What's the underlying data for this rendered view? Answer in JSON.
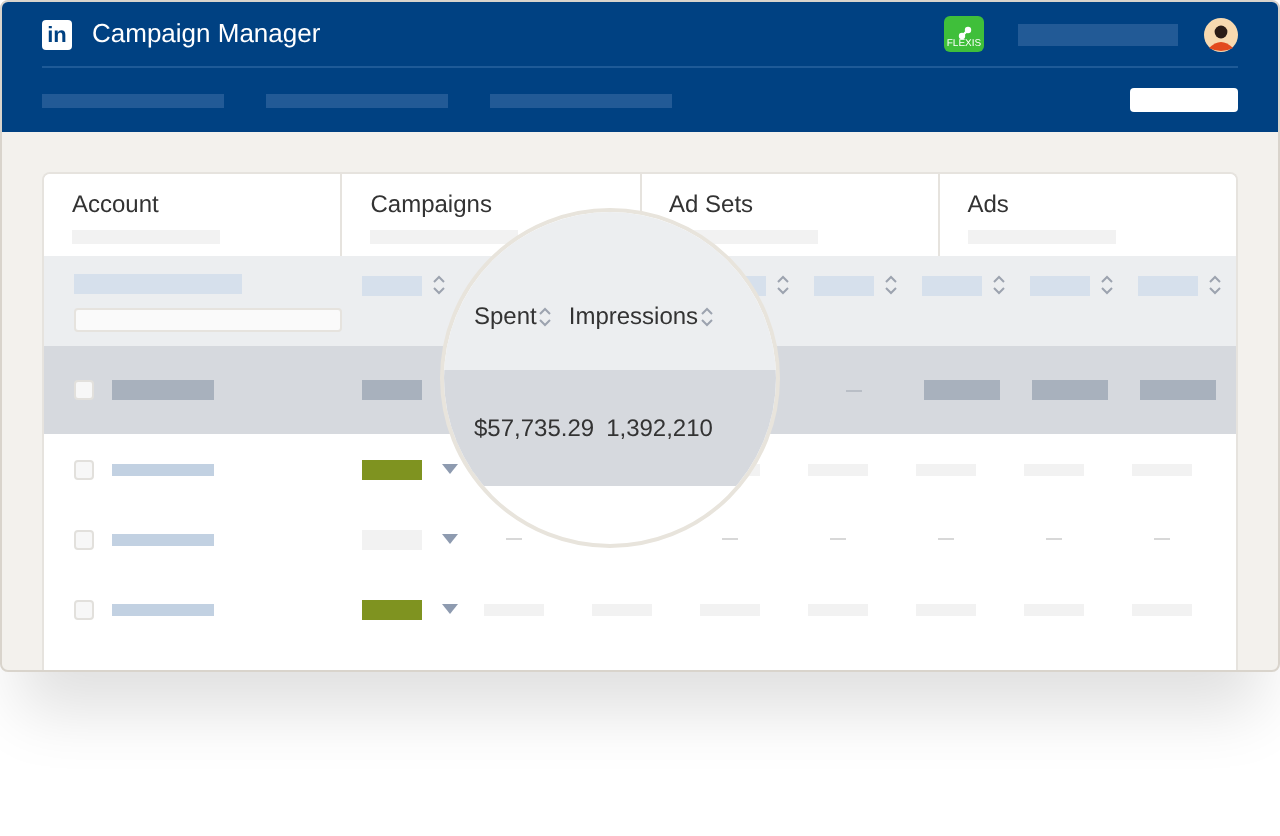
{
  "header": {
    "logo": "in",
    "title": "Campaign Manager",
    "app_icon_label": "FLEXIS"
  },
  "tabs": [
    {
      "label": "Account",
      "selected": false
    },
    {
      "label": "Campaigns",
      "selected": false
    },
    {
      "label": "Ad Sets",
      "selected": false
    },
    {
      "label": "Ads",
      "selected": false
    }
  ],
  "summary_row": {
    "checked": false
  },
  "rows": [
    {
      "checked": false,
      "active": true,
      "kind": "values"
    },
    {
      "checked": false,
      "active": false,
      "kind": "empty"
    },
    {
      "checked": false,
      "active": true,
      "kind": "values"
    }
  ],
  "magnifier": {
    "columns": [
      "Spent",
      "Impressions"
    ],
    "values": [
      "$57,735.29",
      "1,392,210"
    ]
  }
}
